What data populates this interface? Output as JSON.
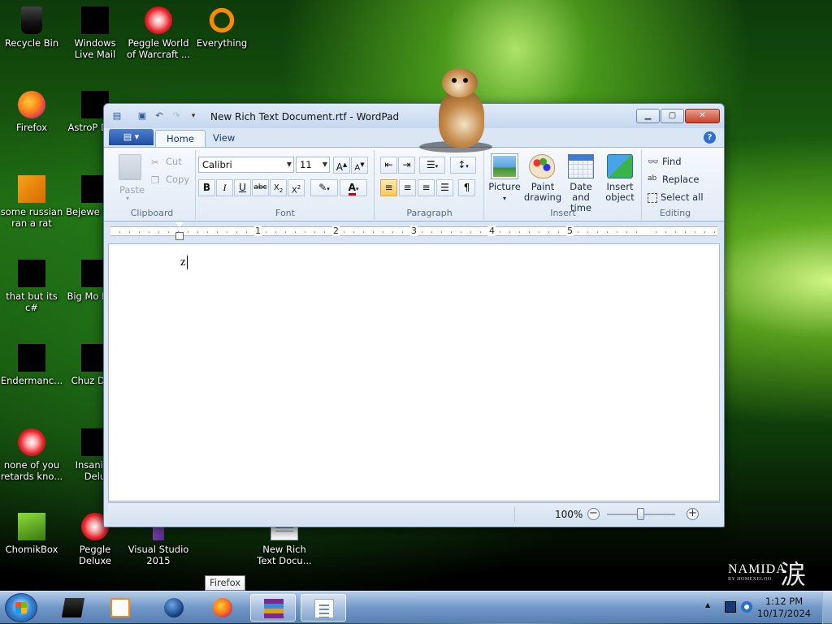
{
  "desktop": {
    "icons": [
      {
        "label": "Recycle Bin"
      },
      {
        "label": "Windows Live Mail"
      },
      {
        "label": "Peggle World of Warcraft ..."
      },
      {
        "label": "Everything"
      },
      {
        "label": "Firefox"
      },
      {
        "label": "AstroP Delu"
      },
      {
        "label": "some russian ran a rat"
      },
      {
        "label": "Bejewe Delu"
      },
      {
        "label": "that but its c#"
      },
      {
        "label": "Big Mo Delu"
      },
      {
        "label": "Endermanc..."
      },
      {
        "label": "Chuz Delu"
      },
      {
        "label": "none of you retards kno..."
      },
      {
        "label": "Insaniqu Delu"
      },
      {
        "label": "ChomikBox"
      },
      {
        "label": "Peggle Deluxe"
      },
      {
        "label": "Visual Studio 2015"
      },
      {
        "label": "New Rich Text Docu..."
      }
    ]
  },
  "window": {
    "title": "New Rich Text Document.rtf - WordPad",
    "tabs": [
      "Home",
      "View"
    ],
    "clipboard": {
      "group": "Clipboard",
      "paste": "Paste",
      "cut": "Cut",
      "copy": "Copy"
    },
    "font": {
      "group": "Font",
      "family": "Calibri",
      "size": "11"
    },
    "paragraph": {
      "group": "Paragraph"
    },
    "insert": {
      "group": "Insert",
      "picture": "Picture",
      "paint1": "Paint",
      "paint2": "drawing",
      "date1": "Date and",
      "date2": "time",
      "obj1": "Insert",
      "obj2": "object"
    },
    "editing": {
      "group": "Editing",
      "find": "Find",
      "replace": "Replace",
      "select_all": "Select all"
    },
    "ruler": [
      "1",
      "2",
      "3",
      "4",
      "5"
    ],
    "document_text": "z",
    "zoom": "100%"
  },
  "tooltip": "Firefox",
  "taskbar": {
    "time": "1:12 PM",
    "date": "10/17/2024"
  },
  "watermark": {
    "brand": "NAMIDA",
    "kanji": "涙",
    "byline": "BY HOMEXELOO"
  },
  "colors": {
    "accent": "#2b5797",
    "taskbar": "#7aa0d2"
  }
}
